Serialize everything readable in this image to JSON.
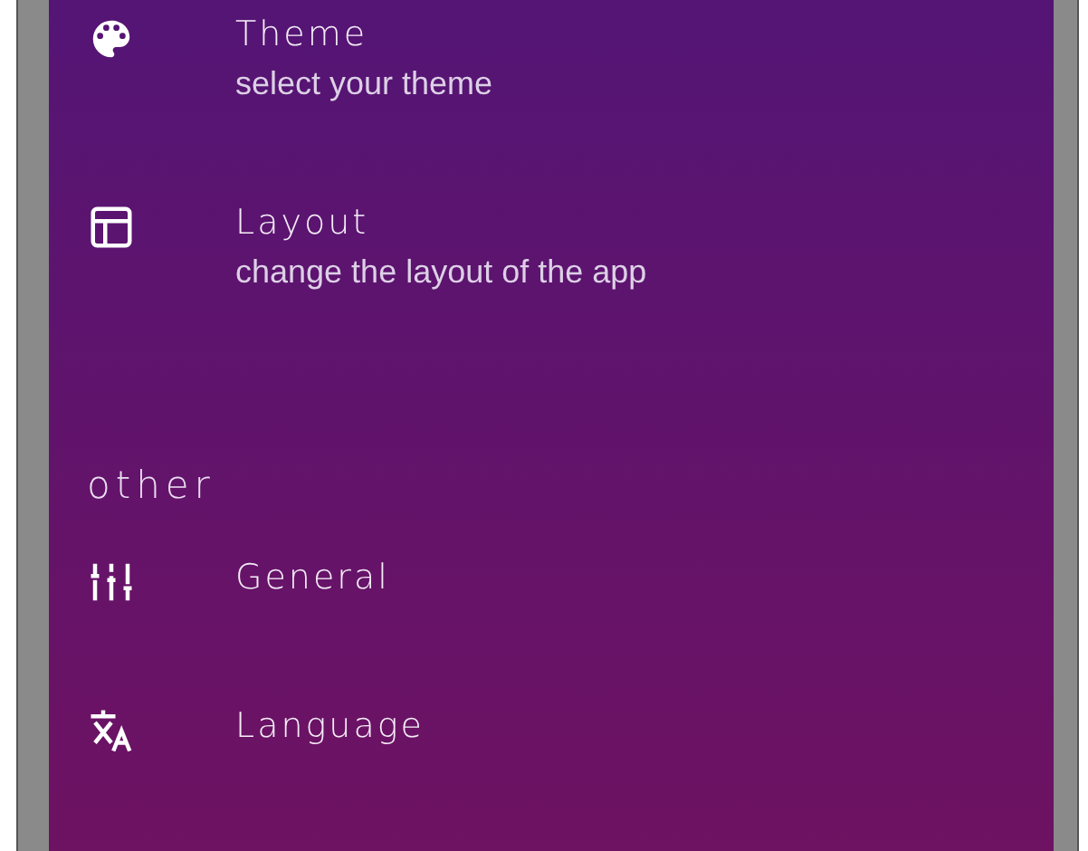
{
  "sections": [
    {
      "items": [
        {
          "kind": "palette",
          "title": "Theme",
          "subtitle": "select your theme"
        },
        {
          "kind": "layout",
          "title": "Layout",
          "subtitle": "change the layout of the app"
        }
      ]
    },
    {
      "header": "other",
      "items": [
        {
          "kind": "tune",
          "title": "General"
        },
        {
          "kind": "translate",
          "title": "Language"
        }
      ]
    }
  ]
}
